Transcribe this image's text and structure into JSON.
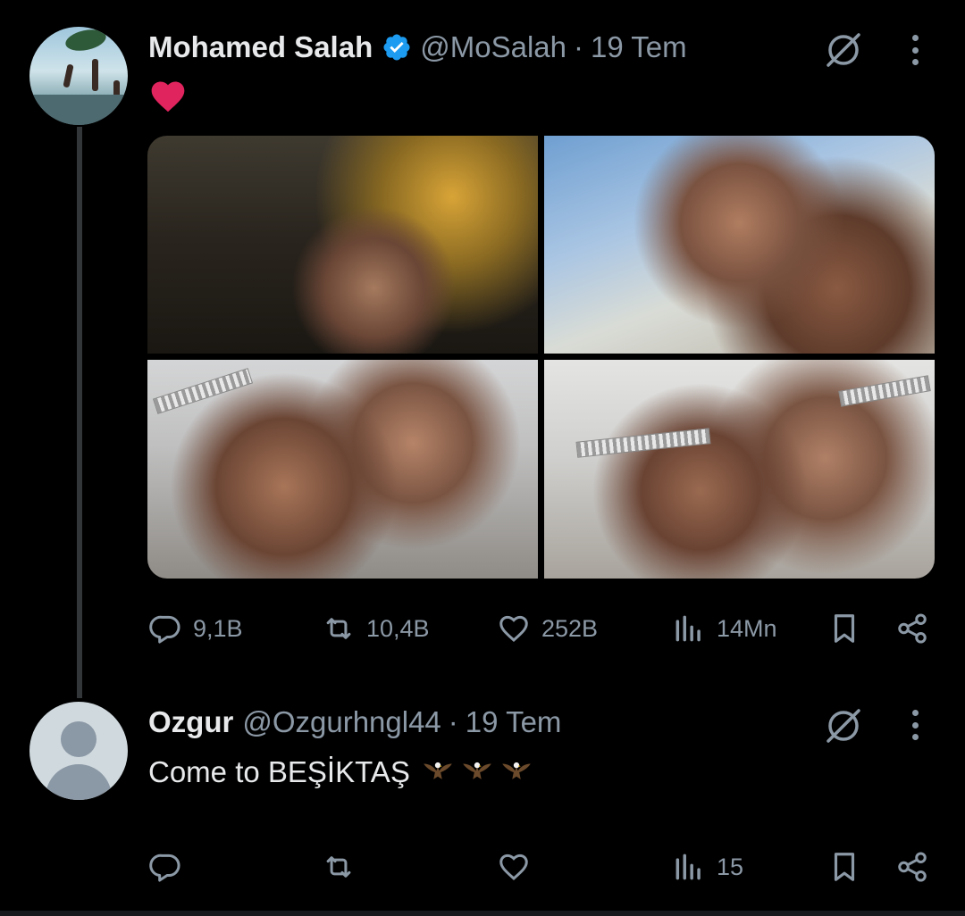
{
  "tweet": {
    "author_name": "Mohamed Salah",
    "handle": "@MoSalah",
    "separator": "·",
    "date": "19 Tem",
    "verified": true,
    "content_emoji": "heart-emoji",
    "photos": [
      "photo-1",
      "photo-2",
      "photo-3",
      "photo-4"
    ],
    "actions": {
      "replies": "9,1B",
      "retweets": "10,4B",
      "likes": "252B",
      "views": "14Mn"
    }
  },
  "reply": {
    "author_name": "Ozgur",
    "handle": "@Ozgurhngl44",
    "separator": "·",
    "date": "19 Tem",
    "text": "Come to BEŞİKTAŞ",
    "emojis": [
      "eagle-emoji",
      "eagle-emoji",
      "eagle-emoji"
    ],
    "actions": {
      "replies": "",
      "retweets": "",
      "likes": "",
      "views": "15"
    }
  },
  "colors": {
    "background": "#000000",
    "text": "#e7e9ea",
    "muted": "#8b98a5",
    "verified": "#1d9bf0",
    "heart": "#f91880"
  }
}
